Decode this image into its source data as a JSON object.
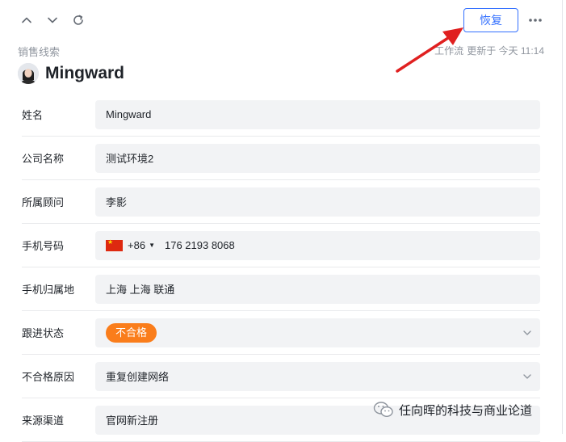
{
  "toolbar": {
    "restore_label": "恢复"
  },
  "record": {
    "category": "销售线索",
    "meta_source": "工作流",
    "meta_updated": "更新于 今天 11:14",
    "title": "Mingward"
  },
  "fields": {
    "name": {
      "label": "姓名",
      "value": "Mingward"
    },
    "company": {
      "label": "公司名称",
      "value": "测试环境2"
    },
    "consultant": {
      "label": "所属顾问",
      "value": "李影"
    },
    "phone": {
      "label": "手机号码",
      "country_code": "+86",
      "number": "176 2193 8068"
    },
    "phone_location": {
      "label": "手机归属地",
      "value": "上海 上海 联通"
    },
    "status": {
      "label": "跟进状态",
      "value": "不合格",
      "color": "#fa7d1b"
    },
    "reason": {
      "label": "不合格原因",
      "value": "重复创建网络"
    },
    "source": {
      "label": "来源渠道",
      "value": "官网新注册"
    }
  },
  "watermark": {
    "text": "任向晖的科技与商业论道"
  },
  "colors": {
    "accent": "#3370ff",
    "arrow": "#e02020"
  }
}
